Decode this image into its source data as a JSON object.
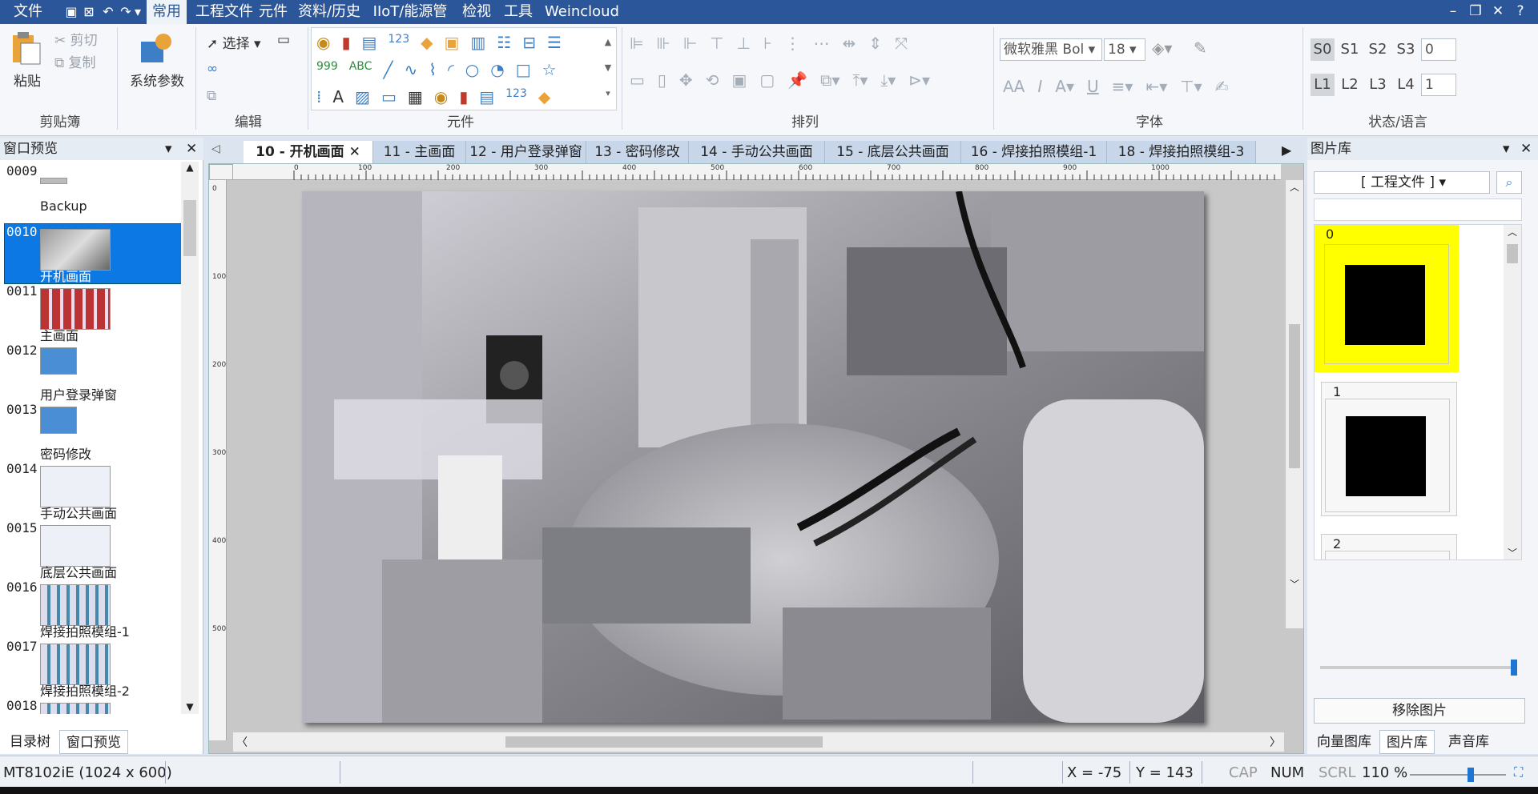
{
  "menubar": {
    "items": [
      "文件",
      "常用",
      "工程文件",
      "元件",
      "资料/历史",
      "IIoT/能源管理",
      "检视",
      "工具",
      "Weincloud"
    ]
  },
  "ribbon": {
    "clipboard": {
      "paste": "粘贴",
      "cut": "剪切",
      "copy": "复制",
      "label": "剪贴簿"
    },
    "system": {
      "params": "系统参数"
    },
    "edit": {
      "select": "选择",
      "label": "编辑"
    },
    "elements": {
      "label": "元件"
    },
    "arrange": {
      "label": "排列"
    },
    "font": {
      "family": "微软雅黑 Bol",
      "size": "18",
      "label": "字体"
    },
    "state": {
      "label": "状态/语言",
      "states": [
        "S0",
        "S1",
        "S2",
        "S3"
      ],
      "state_value": "0",
      "langs": [
        "L1",
        "L2",
        "L3",
        "L4"
      ],
      "lang_value": "1"
    }
  },
  "left_panel": {
    "title": "窗口预览",
    "items": [
      {
        "num": "0009",
        "name": "Backup"
      },
      {
        "num": "0010",
        "name": "开机画面"
      },
      {
        "num": "0011",
        "name": "主画面"
      },
      {
        "num": "0012",
        "name": "用户登录弹窗"
      },
      {
        "num": "0013",
        "name": "密码修改"
      },
      {
        "num": "0014",
        "name": "手动公共画面"
      },
      {
        "num": "0015",
        "name": "底层公共画面"
      },
      {
        "num": "0016",
        "name": "焊接拍照模组-1"
      },
      {
        "num": "0017",
        "name": "焊接拍照模组-2"
      },
      {
        "num": "0018",
        "name": ""
      }
    ],
    "bottom_tabs": [
      "目录树",
      "窗口预览"
    ]
  },
  "doc_tabs": [
    "10 - 开机画面",
    "11 - 主画面",
    "12 - 用户登录弹窗",
    "13 - 密码修改",
    "14 - 手动公共画面",
    "15 - 底层公共画面",
    "16 - 焊接拍照模组-1",
    "18 - 焊接拍照模组-3"
  ],
  "ruler": {
    "h_ticks": [
      "0",
      "100",
      "200",
      "300",
      "400",
      "500",
      "600",
      "700",
      "800",
      "900",
      "1000"
    ],
    "v_ticks": [
      "0",
      "100",
      "200",
      "300",
      "400",
      "500"
    ]
  },
  "right_panel": {
    "title": "图片库",
    "source": "[ 工程文件 ]",
    "items": [
      "0",
      "1",
      "2"
    ],
    "remove_button": "移除图片",
    "bottom_tabs": [
      "向量图库",
      "图片库",
      "声音库"
    ]
  },
  "statusbar": {
    "device": "MT8102iE (1024 x 600)",
    "x": "X = -75",
    "y": "Y = 143",
    "cap": "CAP",
    "num": "NUM",
    "scrl": "SCRL",
    "zoom": "110 %"
  },
  "colors": {
    "title_blue": "#2b579a",
    "selected_blue": "#0b78e3",
    "library_highlight": "#ffff00"
  }
}
